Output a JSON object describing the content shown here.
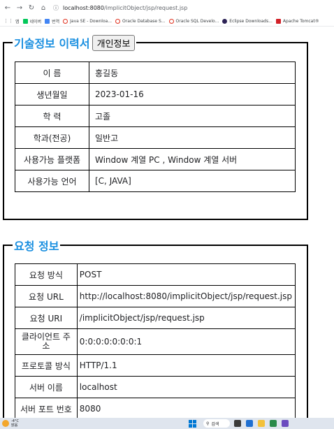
{
  "browser": {
    "url_host": "localhost:8080",
    "url_path": "/implicitObject/jsp/request.jsp",
    "bookmarks": [
      {
        "label": "앱",
        "icon": "apps-grid-icon"
      },
      {
        "label": "네이버",
        "icon": "naver-icon"
      },
      {
        "label": "번역",
        "icon": "translate-icon"
      },
      {
        "label": "Java SE - Downloa...",
        "icon": "oracle-icon"
      },
      {
        "label": "Oracle Database S...",
        "icon": "oracle-icon"
      },
      {
        "label": "Oracle SQL Develo...",
        "icon": "oracle-icon"
      },
      {
        "label": "Eclipse Downloads...",
        "icon": "eclipse-icon"
      },
      {
        "label": "Apache Tomcat®",
        "icon": "tomcat-icon"
      }
    ]
  },
  "section1": {
    "title": "기술정보 이력서",
    "button_label": "개인정보",
    "rows": [
      {
        "key": "이 름",
        "value": "홍길동"
      },
      {
        "key": "생년월일",
        "value": "2023-01-16"
      },
      {
        "key": "학 력",
        "value": "고졸"
      },
      {
        "key": "학과(전공)",
        "value": "일반고"
      },
      {
        "key": "사용가능 플랫폼",
        "value": " Window 계열 PC , Window 계열 서버"
      },
      {
        "key": "사용가능 언어",
        "value": "[C, JAVA]"
      }
    ]
  },
  "section2": {
    "title": "요청 정보",
    "rows": [
      {
        "key": "요청 방식",
        "value": "POST"
      },
      {
        "key": "요청 URL",
        "value": "http://localhost:8080/implicitObject/jsp/request.jsp"
      },
      {
        "key": "요청 URI",
        "value": "/implicitObject/jsp/request.jsp"
      },
      {
        "key": "클라이언트 주소",
        "value": "0:0:0:0:0:0:0:1"
      },
      {
        "key": "프로토콜 방식",
        "value": "HTTP/1.1"
      },
      {
        "key": "서버 이름",
        "value": "localhost"
      },
      {
        "key": "서버 포트 번호",
        "value": "8080"
      }
    ]
  },
  "taskbar": {
    "temperature": "-4°C",
    "weather_text": "맑음",
    "search_label": "검색"
  },
  "colors": {
    "legend_title": "#1a8fe0"
  }
}
